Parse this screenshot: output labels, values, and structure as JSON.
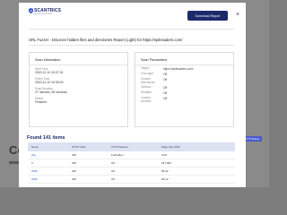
{
  "background": {
    "heading": "Co",
    "chip": "HTTP Status"
  },
  "modal": {
    "logo": {
      "name": "SCANTRICS",
      "tagline": "SECURITY REPORTS"
    },
    "download_button": "Download Report",
    "close_symbol": "×",
    "report_title": "URL Fuzzer - Discover hidden files and directories Report (Light) for https://epilesaders.com/",
    "scan_information": {
      "title": "Scan information",
      "items": [
        {
          "label": "Start Time",
          "value": "2020-12-10 10:07:01"
        },
        {
          "label": "Finish Time",
          "value": "2020-12-10 10:35:00"
        },
        {
          "label": "Scan Duration",
          "value": "27 minutes, 59 seconds"
        },
        {
          "label": "Status",
          "value": "Finished"
        }
      ]
    },
    "scan_parameters": {
      "title": "Scan Parameters",
      "items": [
        {
          "label": "Target:",
          "value": "https://epilesaders.com/"
        },
        {
          "label": "Fuzz type:",
          "value": "Off"
        },
        {
          "label": "Custom extensions:",
          "value": "Off"
        },
        {
          "label": "Options:",
          "value": "Off"
        },
        {
          "label": "Wordlist:",
          "value": "Off"
        },
        {
          "label": "Custom wordlist:",
          "value": "Off"
        }
      ]
    },
    "found_title": "Found 141 items",
    "table": {
      "headers": [
        "Name",
        "HTTP Code",
        "HTTP Reason",
        "Page Size (KB)"
      ],
      "rows": [
        [
          "php",
          "403",
          "Forbidden",
          "0.00"
        ],
        [
          "0",
          "200",
          "OK",
          "157.566"
        ],
        [
          "2006",
          "200",
          "OK",
          "95.02"
        ],
        [
          "2005",
          "200",
          "OK",
          "95.12"
        ]
      ]
    }
  }
}
